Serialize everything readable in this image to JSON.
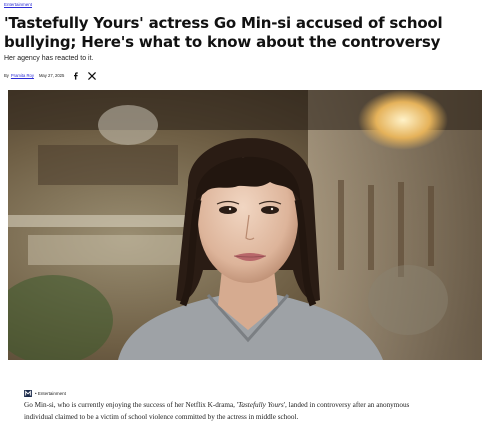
{
  "article": {
    "category": "Entertainment",
    "headline": "'Tastefully Yours' actress Go Min-si accused of school bullying; Here's what to know about the controversy",
    "subhead": "Her agency has reacted to it.",
    "byline": {
      "prefix": "By",
      "author": "Pramita Roy",
      "date": "May 27, 2025"
    },
    "share": {
      "facebook_icon": "facebook-icon",
      "x_icon": "x-icon"
    },
    "hero_image": {
      "alt": "Go Min-si"
    },
    "source": {
      "logo_icon": "publisher-logo-icon",
      "label": "• Entertainment"
    },
    "body": {
      "part1": "Go Min-si, who is currently enjoying the success of her Netflix K-drama, '",
      "title_italic": "Tastefully Yours",
      "part2": "', landed in controversy after an anonymous individual claimed to be a victim of school violence committed by the actress in middle school."
    }
  }
}
